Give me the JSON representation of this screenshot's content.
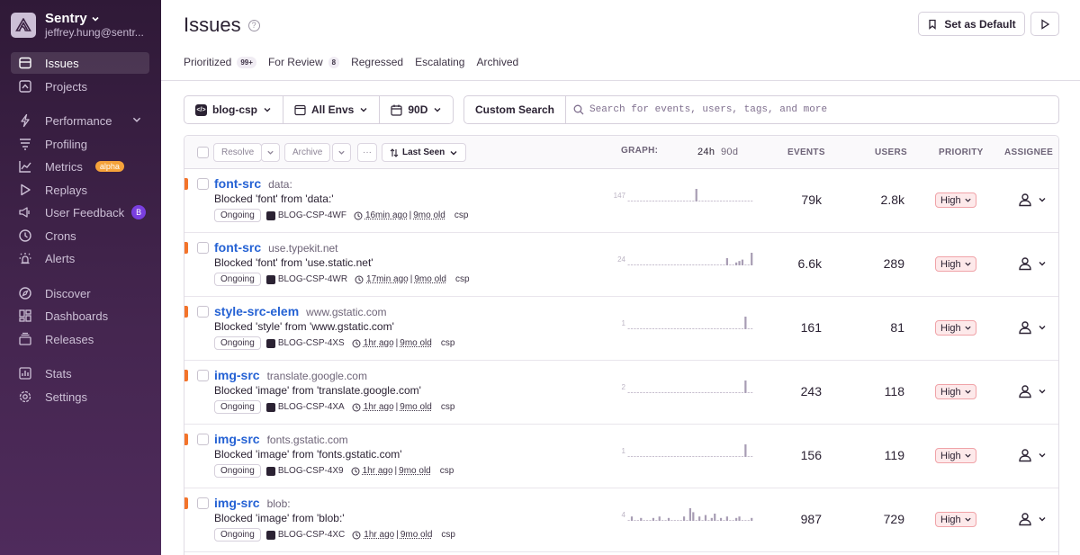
{
  "org": {
    "name": "Sentry",
    "email": "jeffrey.hung@sentr..."
  },
  "nav": [
    {
      "label": "Issues",
      "icon": "issues-icon",
      "active": true
    },
    {
      "label": "Projects",
      "icon": "projects-icon"
    },
    {
      "label": "Performance",
      "icon": "performance-icon",
      "chevron": true
    },
    {
      "label": "Profiling",
      "icon": "profiling-icon"
    },
    {
      "label": "Metrics",
      "icon": "metrics-icon",
      "badge": "alpha"
    },
    {
      "label": "Replays",
      "icon": "replays-icon"
    },
    {
      "label": "User Feedback",
      "icon": "user-feedback-icon",
      "badge_beta": "B"
    },
    {
      "label": "Crons",
      "icon": "crons-icon"
    },
    {
      "label": "Alerts",
      "icon": "alerts-icon"
    },
    {
      "label": "Discover",
      "icon": "discover-icon"
    },
    {
      "label": "Dashboards",
      "icon": "dashboards-icon"
    },
    {
      "label": "Releases",
      "icon": "releases-icon"
    },
    {
      "label": "Stats",
      "icon": "stats-icon"
    },
    {
      "label": "Settings",
      "icon": "settings-icon"
    }
  ],
  "header": {
    "title": "Issues",
    "set_default": "Set as Default",
    "tabs": [
      {
        "label": "Prioritized",
        "count": "99+"
      },
      {
        "label": "For Review",
        "count": "8"
      },
      {
        "label": "Regressed"
      },
      {
        "label": "Escalating"
      },
      {
        "label": "Archived"
      }
    ]
  },
  "filters": {
    "project": "blog-csp",
    "env": "All Envs",
    "period": "90D"
  },
  "search": {
    "custom_label": "Custom Search",
    "placeholder": "Search for events, users, tags, and more"
  },
  "table_header": {
    "resolve": "Resolve",
    "archive": "Archive",
    "more": "···",
    "sort": "Last Seen",
    "graph": "GRAPH:",
    "graph_24h": "24h",
    "graph_90d": "90d",
    "events": "EVENTS",
    "users": "USERS",
    "priority": "PRIORITY",
    "assignee": "ASSIGNEE"
  },
  "issues": [
    {
      "title": "font-src",
      "culprit": "data:",
      "message": "Blocked 'font' from 'data:'",
      "status": "Ongoing",
      "short_id": "BLOG-CSP-4WF",
      "last_seen": "16min ago",
      "age": "9mo old",
      "tag": "csp",
      "graph_max": "147",
      "graph": [
        0,
        0,
        0,
        0,
        0,
        0,
        0,
        0,
        0,
        0,
        0,
        0,
        0,
        0,
        0,
        0,
        0,
        0,
        0,
        0,
        0,
        0,
        1,
        0,
        0,
        0,
        0,
        0,
        0,
        0,
        0,
        0,
        0,
        0,
        0,
        0,
        0,
        0,
        0,
        0,
        0
      ],
      "events": "79k",
      "users": "2.8k",
      "priority": "High"
    },
    {
      "title": "font-src",
      "culprit": "use.typekit.net",
      "message": "Blocked 'font' from 'use.static.net'",
      "status": "Ongoing",
      "short_id": "BLOG-CSP-4WR",
      "last_seen": "17min ago",
      "age": "9mo old",
      "tag": "csp",
      "graph_max": "24",
      "graph": [
        0,
        0,
        0,
        0,
        0,
        0,
        0,
        0,
        0,
        0,
        0,
        0,
        0,
        0,
        0,
        0,
        0,
        0,
        0,
        0,
        0,
        0,
        0,
        0,
        0,
        0,
        0,
        0,
        0,
        0,
        0,
        0,
        0.5,
        0,
        0,
        0.2,
        0.3,
        0.4,
        0,
        0,
        1
      ],
      "events": "6.6k",
      "users": "289",
      "priority": "High"
    },
    {
      "title": "style-src-elem",
      "culprit": "www.gstatic.com",
      "message": "Blocked 'style' from 'www.gstatic.com'",
      "status": "Ongoing",
      "short_id": "BLOG-CSP-4XS",
      "last_seen": "1hr ago",
      "age": "9mo old",
      "tag": "csp",
      "graph_max": "1",
      "graph": [
        0,
        0,
        0,
        0,
        0,
        0,
        0,
        0,
        0,
        0,
        0,
        0,
        0,
        0,
        0,
        0,
        0,
        0,
        0,
        0,
        0,
        0,
        0,
        0,
        0,
        0,
        0,
        0,
        0,
        0,
        0,
        0,
        0,
        0,
        0,
        0,
        0,
        0,
        1,
        0,
        0
      ],
      "events": "161",
      "users": "81",
      "priority": "High"
    },
    {
      "title": "img-src",
      "culprit": "translate.google.com",
      "message": "Blocked 'image' from 'translate.google.com'",
      "status": "Ongoing",
      "short_id": "BLOG-CSP-4XA",
      "last_seen": "1hr ago",
      "age": "9mo old",
      "tag": "csp",
      "graph_max": "2",
      "graph": [
        0,
        0,
        0,
        0,
        0,
        0,
        0,
        0,
        0,
        0,
        0,
        0,
        0,
        0,
        0,
        0,
        0,
        0,
        0,
        0,
        0,
        0,
        0,
        0,
        0,
        0,
        0,
        0,
        0,
        0,
        0,
        0,
        0,
        0,
        0,
        0,
        0,
        0,
        1,
        0,
        0
      ],
      "events": "243",
      "users": "118",
      "priority": "High"
    },
    {
      "title": "img-src",
      "culprit": "fonts.gstatic.com",
      "message": "Blocked 'image' from 'fonts.gstatic.com'",
      "status": "Ongoing",
      "short_id": "BLOG-CSP-4X9",
      "last_seen": "1hr ago",
      "age": "9mo old",
      "tag": "csp",
      "graph_max": "1",
      "graph": [
        0,
        0,
        0,
        0,
        0,
        0,
        0,
        0,
        0,
        0,
        0,
        0,
        0,
        0,
        0,
        0,
        0,
        0,
        0,
        0,
        0,
        0,
        0,
        0,
        0,
        0,
        0,
        0,
        0,
        0,
        0,
        0,
        0,
        0,
        0,
        0,
        0,
        0,
        1,
        0,
        0
      ],
      "events": "156",
      "users": "119",
      "priority": "High"
    },
    {
      "title": "img-src",
      "culprit": "blob:",
      "message": "Blocked 'image' from 'blob:'",
      "status": "Ongoing",
      "short_id": "BLOG-CSP-4XC",
      "last_seen": "1hr ago",
      "age": "9mo old",
      "tag": "csp",
      "graph_max": "4",
      "graph": [
        0,
        0.3,
        0,
        0,
        0.2,
        0,
        0,
        0,
        0.2,
        0,
        0.3,
        0,
        0,
        0.2,
        0,
        0,
        0,
        0,
        0.3,
        0,
        1,
        0.6,
        0,
        0.3,
        0,
        0.4,
        0,
        0.2,
        0.5,
        0,
        0.2,
        0,
        0.3,
        0,
        0,
        0.2,
        0.3,
        0,
        0,
        0,
        0.2
      ],
      "events": "987",
      "users": "729",
      "priority": "High"
    }
  ]
}
